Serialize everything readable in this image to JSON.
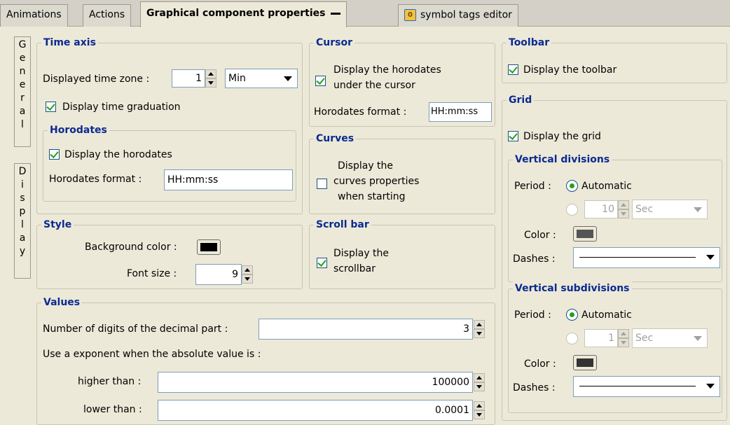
{
  "tabs": {
    "animations": "Animations",
    "actions": "Actions",
    "graphical": "Graphical component properties",
    "symbol_tags": "symbol tags editor"
  },
  "side_tabs": {
    "general": [
      "G",
      "e",
      "n",
      "e",
      "r",
      "a",
      "l"
    ],
    "display": [
      "D",
      "i",
      "s",
      "p",
      "l",
      "a",
      "y"
    ]
  },
  "time_axis": {
    "title": "Time axis",
    "zone_label": "Displayed time zone :",
    "zone_value": "1",
    "zone_unit": "Min",
    "graduation_label": "Display time graduation",
    "graduation_checked": true
  },
  "horodates": {
    "title": "Horodates",
    "display_label": "Display the horodates",
    "display_checked": true,
    "format_label": "Horodates format :",
    "format_value": "HH:mm:ss"
  },
  "cursor": {
    "title": "Cursor",
    "display_line1": "Display the horodates",
    "display_line2": "under the cursor",
    "display_checked": true,
    "format_label": "Horodates format :",
    "format_value": "HH:mm:ss"
  },
  "curves": {
    "title": "Curves",
    "line1": "Display the",
    "line2": "curves properties",
    "line3": "when starting",
    "checked": false
  },
  "style": {
    "title": "Style",
    "bg_label": "Background color :",
    "bg_color": "#000000",
    "font_label": "Font size :",
    "font_value": "9"
  },
  "scrollbar": {
    "title": "Scroll bar",
    "line1": "Display the",
    "line2": "scrollbar",
    "checked": true
  },
  "values": {
    "title": "Values",
    "digits_label": "Number of digits of the decimal part :",
    "digits_value": "3",
    "exponent_label": "Use a exponent when the absolute value is :",
    "higher_label": "higher than :",
    "higher_value": "100000",
    "lower_label": "lower than :",
    "lower_value": "0.0001"
  },
  "toolbar": {
    "title": "Toolbar",
    "display_label": "Display the toolbar",
    "checked": true
  },
  "grid": {
    "title": "Grid",
    "display_label": "Display the grid",
    "checked": true
  },
  "vdiv": {
    "title": "Vertical divisions",
    "period_label": "Period :",
    "automatic_label": "Automatic",
    "num_value": "10",
    "unit_value": "Sec",
    "color_label": "Color :",
    "color": "#555555",
    "dashes_label": "Dashes :"
  },
  "vsub": {
    "title": "Vertical subdivisions",
    "period_label": "Period :",
    "automatic_label": "Automatic",
    "num_value": "1",
    "unit_value": "Sec",
    "color_label": "Color :",
    "color": "#333333",
    "dashes_label": "Dashes :"
  }
}
